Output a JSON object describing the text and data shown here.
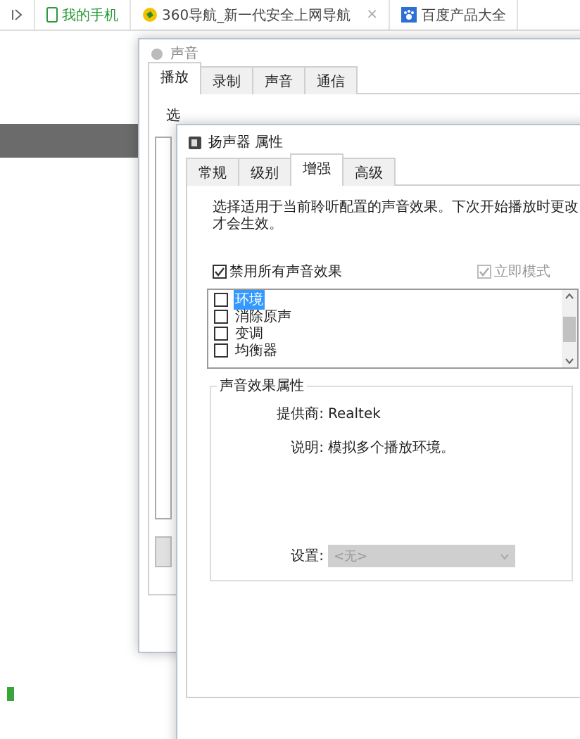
{
  "browser_tabs": [
    {
      "label": "我的手机",
      "kind": "phone"
    },
    {
      "label": "360导航_新一代安全上网导航",
      "kind": "site",
      "close": "×"
    },
    {
      "label": "百度产品大全",
      "kind": "paw"
    }
  ],
  "sound_window": {
    "title": "声音",
    "tabs": [
      {
        "label": "播放",
        "selected": true
      },
      {
        "label": "录制",
        "selected": false
      },
      {
        "label": "声音",
        "selected": false
      },
      {
        "label": "通信",
        "selected": false
      }
    ],
    "cut_text": "选"
  },
  "speaker_window": {
    "title": "扬声器 属性",
    "tabs": [
      {
        "label": "常规",
        "selected": false
      },
      {
        "label": "级别",
        "selected": false
      },
      {
        "label": "增强",
        "selected": true
      },
      {
        "label": "高级",
        "selected": false
      }
    ],
    "description": "选择适用于当前聆听配置的声音效果。下次开始播放时更改才会生效。",
    "disable_all": {
      "label": "禁用所有声音效果",
      "checked": true
    },
    "immediate_mode": {
      "label": "立即模式",
      "checked": true,
      "disabled": true
    },
    "effects": [
      {
        "label": "环境",
        "checked": false,
        "selected": true
      },
      {
        "label": "消除原声",
        "checked": false,
        "selected": false
      },
      {
        "label": "变调",
        "checked": false,
        "selected": false
      },
      {
        "label": "均衡器",
        "checked": false,
        "selected": false
      }
    ],
    "properties": {
      "title": "声音效果属性",
      "provider_label": "提供商:",
      "provider": "Realtek",
      "description_label": "说明:",
      "description": "模拟多个播放环境。",
      "settings_label": "设置:",
      "settings_value": "<无>",
      "settings_disabled": true
    }
  }
}
